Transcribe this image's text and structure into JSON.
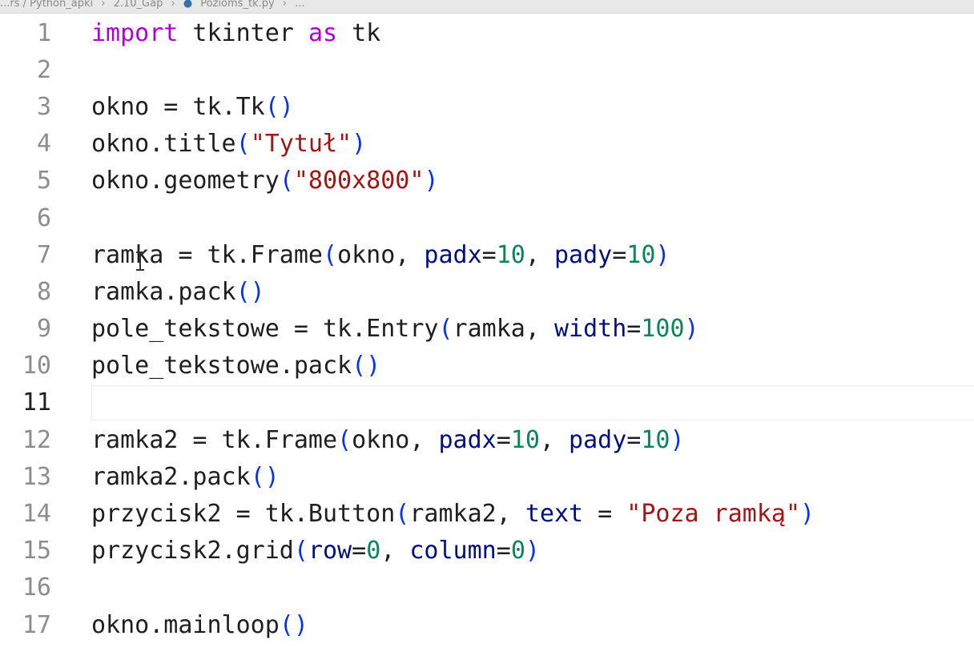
{
  "breadcrumb": {
    "part1": "...rs / Python_apki",
    "part2": "2.10_Gap",
    "part3": "Pozioms_tk.py",
    "part4": "..."
  },
  "editor": {
    "current_line": 11,
    "lines": [
      {
        "num": "1"
      },
      {
        "num": "2"
      },
      {
        "num": "3"
      },
      {
        "num": "4"
      },
      {
        "num": "5"
      },
      {
        "num": "6"
      },
      {
        "num": "7"
      },
      {
        "num": "8"
      },
      {
        "num": "9"
      },
      {
        "num": "10"
      },
      {
        "num": "11"
      },
      {
        "num": "12"
      },
      {
        "num": "13"
      },
      {
        "num": "14"
      },
      {
        "num": "15"
      },
      {
        "num": "16"
      },
      {
        "num": "17"
      }
    ],
    "tokens": {
      "import": "import",
      "tkinter": " tkinter ",
      "as": "as",
      "tk": " tk",
      "okno_eq": "okno = tk.Tk",
      "okno_title": "okno.title",
      "str_tytul": "\"Tytuł\"",
      "okno_geometry": "okno.geometry",
      "str_800": "\"800x800\"",
      "ramka_eq": "ramka = tk.Frame",
      "okno_arg": "okno, ",
      "padx": "padx",
      "pady": "pady",
      "eq": "=",
      "ten": "10",
      "comma": ", ",
      "ramka_pack": "ramka.pack",
      "pole_eq": "pole_tekstowe = tk.Entry",
      "ramka_arg": "ramka, ",
      "width": "width",
      "hundred": "100",
      "pole_pack": "pole_tekstowe.pack",
      "ramka2_eq": "ramka2 = tk.Frame",
      "ramka2_pack": "ramka2.pack",
      "przycisk_eq": "przycisk2 = tk.Button",
      "ramka2_arg": "ramka2, ",
      "text": "text",
      "spaced_eq": " = ",
      "str_poza": "\"Poza ramką\"",
      "przycisk_grid": "przycisk2.grid",
      "row": "row",
      "column": "column",
      "zero": "0",
      "mainloop": "okno.mainloop",
      "lp": "(",
      "rp": ")",
      "lprp": "()"
    }
  }
}
